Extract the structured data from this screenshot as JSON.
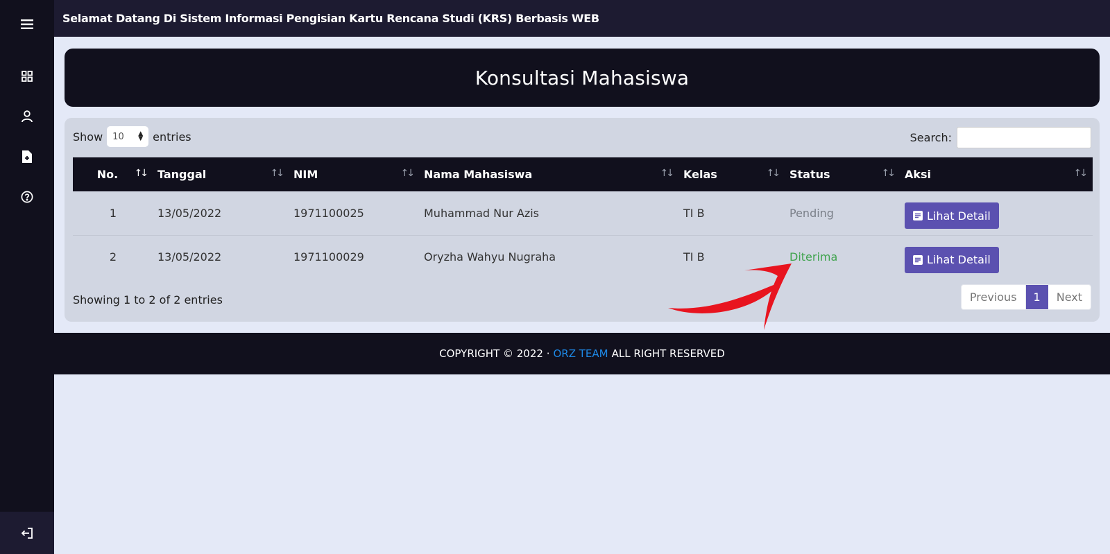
{
  "topbar": {
    "marquee": "Selamat Datang Di Sistem Informasi Pengisian Kartu Rencana Studi (KRS) Berbasis WEB"
  },
  "sidebar": {
    "items": [
      {
        "icon": "menu-icon"
      },
      {
        "icon": "grid-icon"
      },
      {
        "icon": "user-icon"
      },
      {
        "icon": "file-icon"
      },
      {
        "icon": "help-icon"
      }
    ],
    "bottom_icon": "logout-icon"
  },
  "page": {
    "title": "Konsultasi Mahasiswa"
  },
  "controls": {
    "show_label": "Show",
    "entries_value": "10",
    "entries_label": "entries",
    "search_label": "Search:",
    "search_placeholder": ""
  },
  "table": {
    "headers": [
      "No.",
      "Tanggal",
      "NIM",
      "Nama Mahasiswa",
      "Kelas",
      "Status",
      "Aksi"
    ],
    "rows": [
      {
        "no": "1",
        "tanggal": "13/05/2022",
        "nim": "1971100025",
        "nama": "Muhammad Nur Azis",
        "kelas": "TI B",
        "status": "Pending",
        "aksi": "Lihat Detail"
      },
      {
        "no": "2",
        "tanggal": "13/05/2022",
        "nim": "1971100029",
        "nama": "Oryzha Wahyu Nugraha",
        "kelas": "TI B",
        "status": "Diterima",
        "aksi": "Lihat Detail"
      }
    ]
  },
  "pagination": {
    "info": "Showing 1 to 2 of 2 entries",
    "previous": "Previous",
    "current": "1",
    "next": "Next"
  },
  "footer": {
    "prefix": "COPYRIGHT © 2022 ·",
    "team": "ORZ TEAM",
    "suffix": "ALL RIGHT RESERVED"
  },
  "colors": {
    "sidebar": "#11101d",
    "topbar": "#1d1b31",
    "background": "#e4e9f7",
    "accent": "#5b51b0",
    "status_pending": "#7a7f88",
    "status_accepted": "#3fa34d",
    "annotation_arrow": "#e8141f",
    "footer_link": "#1e88e5"
  }
}
